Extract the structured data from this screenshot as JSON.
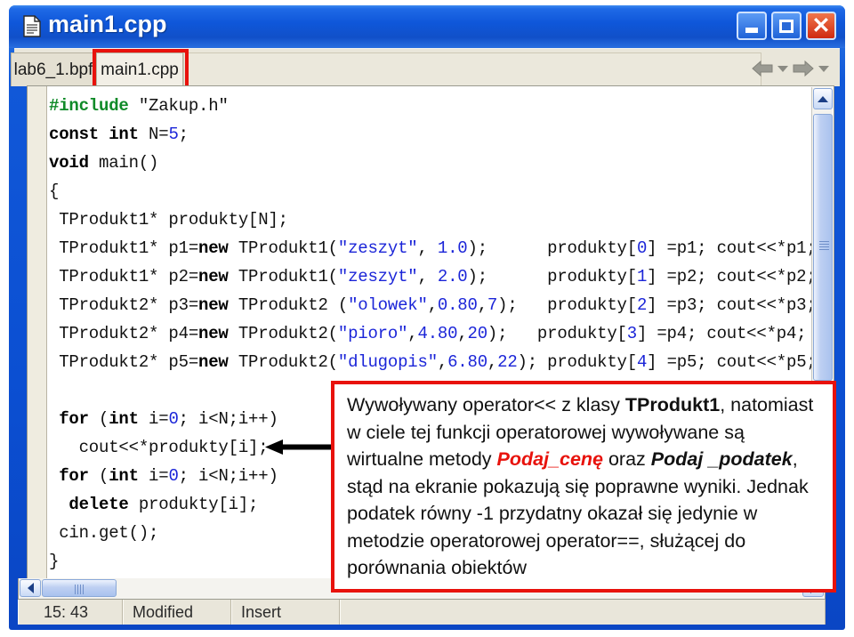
{
  "window": {
    "title": "main1.cpp",
    "icon": "document-icon",
    "buttons": {
      "minimize": "_",
      "maximize": "□",
      "close": "✕"
    },
    "accent_color": "#0b4fd2",
    "highlight_color": "#e8120c"
  },
  "tabs": [
    {
      "label": "lab6_1.bpf",
      "active": false,
      "highlighted": false
    },
    {
      "label": "main1.cpp",
      "active": true,
      "highlighted": true
    }
  ],
  "nav": {
    "back": "back-arrow",
    "back_dropdown": "chevron-down-icon",
    "forward": "forward-arrow",
    "forward_dropdown": "chevron-down-icon"
  },
  "editor": {
    "lines": [
      [
        {
          "t": "#include ",
          "c": "pp"
        },
        {
          "t": "\"Zakup.h\"",
          "c": "plain"
        }
      ],
      [
        {
          "t": "const int ",
          "c": "kw"
        },
        {
          "t": "N=",
          "c": "plain"
        },
        {
          "t": "5",
          "c": "num"
        },
        {
          "t": ";",
          "c": "plain"
        }
      ],
      [
        {
          "t": "void ",
          "c": "kw"
        },
        {
          "t": "main()",
          "c": "plain"
        }
      ],
      [
        {
          "t": "{",
          "c": "plain"
        }
      ],
      [
        {
          "t": " TProdukt1* produkty[N];",
          "c": "plain"
        }
      ],
      [
        {
          "t": " TProdukt1* p1=",
          "c": "plain"
        },
        {
          "t": "new",
          "c": "kw"
        },
        {
          "t": " TProdukt1(",
          "c": "plain"
        },
        {
          "t": "\"zeszyt\"",
          "c": "str"
        },
        {
          "t": ", ",
          "c": "plain"
        },
        {
          "t": "1.0",
          "c": "num"
        },
        {
          "t": ");      produkty[",
          "c": "plain"
        },
        {
          "t": "0",
          "c": "num"
        },
        {
          "t": "] =p1; cout<<*p1;",
          "c": "plain"
        }
      ],
      [
        {
          "t": " TProdukt1* p2=",
          "c": "plain"
        },
        {
          "t": "new",
          "c": "kw"
        },
        {
          "t": " TProdukt1(",
          "c": "plain"
        },
        {
          "t": "\"zeszyt\"",
          "c": "str"
        },
        {
          "t": ", ",
          "c": "plain"
        },
        {
          "t": "2.0",
          "c": "num"
        },
        {
          "t": ");      produkty[",
          "c": "plain"
        },
        {
          "t": "1",
          "c": "num"
        },
        {
          "t": "] =p2; cout<<*p2;",
          "c": "plain"
        }
      ],
      [
        {
          "t": " TProdukt2* p3=",
          "c": "plain"
        },
        {
          "t": "new",
          "c": "kw"
        },
        {
          "t": " TProdukt2 (",
          "c": "plain"
        },
        {
          "t": "\"olowek\"",
          "c": "str"
        },
        {
          "t": ",",
          "c": "plain"
        },
        {
          "t": "0.80",
          "c": "num"
        },
        {
          "t": ",",
          "c": "plain"
        },
        {
          "t": "7",
          "c": "num"
        },
        {
          "t": ");   produkty[",
          "c": "plain"
        },
        {
          "t": "2",
          "c": "num"
        },
        {
          "t": "] =p3; cout<<*p3;",
          "c": "plain"
        }
      ],
      [
        {
          "t": " TProdukt2* p4=",
          "c": "plain"
        },
        {
          "t": "new",
          "c": "kw"
        },
        {
          "t": " TProdukt2(",
          "c": "plain"
        },
        {
          "t": "\"pioro\"",
          "c": "str"
        },
        {
          "t": ",",
          "c": "plain"
        },
        {
          "t": "4.80",
          "c": "num"
        },
        {
          "t": ",",
          "c": "plain"
        },
        {
          "t": "20",
          "c": "num"
        },
        {
          "t": ");   produkty[",
          "c": "plain"
        },
        {
          "t": "3",
          "c": "num"
        },
        {
          "t": "] =p4; cout<<*p4;",
          "c": "plain"
        }
      ],
      [
        {
          "t": " TProdukt2* p5=",
          "c": "plain"
        },
        {
          "t": "new",
          "c": "kw"
        },
        {
          "t": " TProdukt2(",
          "c": "plain"
        },
        {
          "t": "\"dlugopis\"",
          "c": "str"
        },
        {
          "t": ",",
          "c": "plain"
        },
        {
          "t": "6.80",
          "c": "num"
        },
        {
          "t": ",",
          "c": "plain"
        },
        {
          "t": "22",
          "c": "num"
        },
        {
          "t": "); produkty[",
          "c": "plain"
        },
        {
          "t": "4",
          "c": "num"
        },
        {
          "t": "] =p5; cout<<*p5;",
          "c": "plain"
        }
      ],
      [],
      [
        {
          "t": " ",
          "c": "plain"
        },
        {
          "t": "for",
          "c": "kw"
        },
        {
          "t": " (",
          "c": "plain"
        },
        {
          "t": "int",
          "c": "kw"
        },
        {
          "t": " i=",
          "c": "plain"
        },
        {
          "t": "0",
          "c": "num"
        },
        {
          "t": "; i<N;i++)",
          "c": "plain"
        }
      ],
      [
        {
          "t": "   cout<<*produkty[i];",
          "c": "plain"
        }
      ],
      [
        {
          "t": " ",
          "c": "plain"
        },
        {
          "t": "for",
          "c": "kw"
        },
        {
          "t": " (",
          "c": "plain"
        },
        {
          "t": "int",
          "c": "kw"
        },
        {
          "t": " i=",
          "c": "plain"
        },
        {
          "t": "0",
          "c": "num"
        },
        {
          "t": "; i<N;i++)",
          "c": "plain"
        }
      ],
      [
        {
          "t": "  ",
          "c": "plain"
        },
        {
          "t": "delete",
          "c": "kw"
        },
        {
          "t": " produkty[i];",
          "c": "plain"
        }
      ],
      [
        {
          "t": " cin.get();",
          "c": "plain"
        }
      ],
      [
        {
          "t": "}",
          "c": "plain"
        }
      ]
    ],
    "vertical_scrollbar": {
      "up": "chevron-up-icon",
      "down": "chevron-down-icon"
    },
    "horizontal_scrollbar": {
      "left": "chevron-left-icon",
      "right": "chevron-right-icon"
    }
  },
  "callout": {
    "parts": [
      {
        "t": "Wywoływany operator<< z klasy ",
        "s": "plain"
      },
      {
        "t": "TProdukt1",
        "s": "bold"
      },
      {
        "t": ", natomiast w ciele tej funkcji operatorowej wywoływane są wirtualne metody ",
        "s": "plain"
      },
      {
        "t": "Podaj_cenę",
        "s": "red-bold-italic"
      },
      {
        "t": " oraz ",
        "s": "plain"
      },
      {
        "t": "Podaj _podatek",
        "s": "bold-italic"
      },
      {
        "t": ", stąd na ekranie pokazują się poprawne wyniki. Jednak podatek równy -1 przydatny okazał się jedynie w metodzie operatorowej operator==, służącej do porównania obiektów",
        "s": "plain"
      }
    ]
  },
  "statusbar": {
    "position": "15: 43",
    "modified": "Modified",
    "insert": "Insert"
  }
}
